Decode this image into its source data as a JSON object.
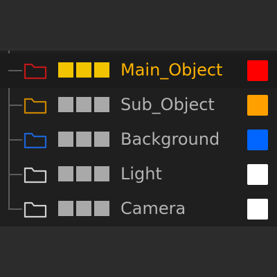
{
  "layers": [
    {
      "name": "Main_Object",
      "folder_color": "#c01818",
      "swatch_color": "#ff0000",
      "selected": true
    },
    {
      "name": "Sub_Object",
      "folder_color": "#c98500",
      "swatch_color": "#ffa000",
      "selected": false
    },
    {
      "name": "Background",
      "folder_color": "#1d63d4",
      "swatch_color": "#0066ff",
      "selected": false
    },
    {
      "name": "Light",
      "folder_color": "#d0d0d0",
      "swatch_color": "#ffffff",
      "selected": false
    },
    {
      "name": "Camera",
      "folder_color": "#d0d0d0",
      "swatch_color": "#ffffff",
      "selected": false
    }
  ],
  "icons": {
    "folder": "folder-icon"
  },
  "colors": {
    "selected_text": "#ffb400",
    "selected_square": "#f2c400",
    "unselected_text": "#b3b3b3",
    "unselected_square": "#a9a9a9"
  }
}
